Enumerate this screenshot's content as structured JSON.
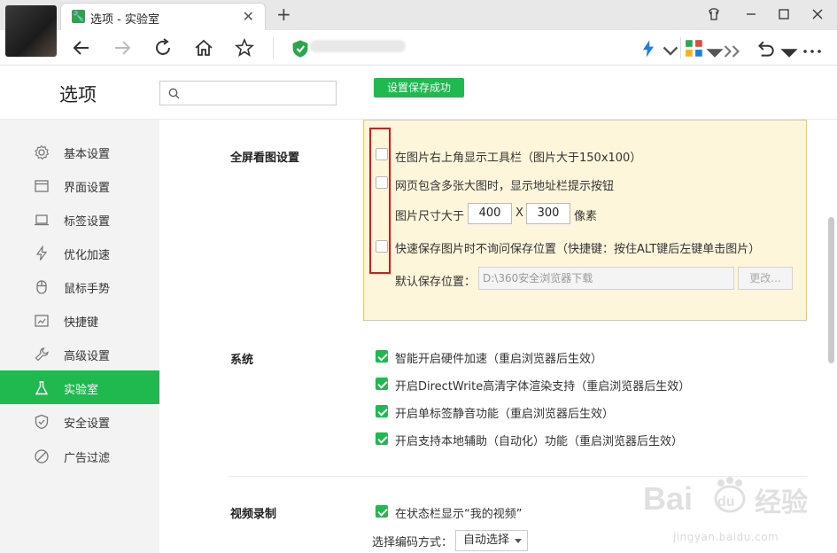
{
  "browser": {
    "tab_title": "选项 - 实验室",
    "tab_favicon": "wrench-icon",
    "new_tab_glyph": "+",
    "close_glyph": "✕"
  },
  "page": {
    "title": "选项",
    "search_placeholder": "",
    "save_notice": "设置保存成功"
  },
  "sidebar": {
    "items": [
      {
        "label": "基本设置",
        "icon": "gear-icon"
      },
      {
        "label": "界面设置",
        "icon": "window-icon"
      },
      {
        "label": "标签设置",
        "icon": "tab-icon"
      },
      {
        "label": "优化加速",
        "icon": "lightning-icon"
      },
      {
        "label": "鼠标手势",
        "icon": "mouse-icon"
      },
      {
        "label": "快捷键",
        "icon": "keyboard-icon"
      },
      {
        "label": "高级设置",
        "icon": "wrench-icon"
      },
      {
        "label": "实验室",
        "icon": "flask-icon",
        "active": true
      },
      {
        "label": "安全设置",
        "icon": "shield-icon"
      },
      {
        "label": "广告过滤",
        "icon": "block-icon"
      }
    ]
  },
  "fullscreen": {
    "title": "全屏看图设置",
    "opt1": "在图片右上角显示工具栏（图片大于150x100）",
    "opt2": "网页包含多张大图时，显示地址栏提示按钮",
    "size_label": "图片尺寸大于",
    "width": "400",
    "x": "X",
    "height": "300",
    "unit": "像素",
    "opt3": "快速保存图片时不询问保存位置（快捷键：按住ALT键后左键单击图片）",
    "path_label": "默认保存位置：",
    "path_value": "D:\\360安全浏览器下载",
    "change_label": "更改..."
  },
  "system": {
    "title": "系统",
    "options": [
      "智能开启硬件加速（重启浏览器后生效）",
      "开启DirectWrite高清字体渲染支持（重启浏览器后生效）",
      "开启单标签静音功能（重启浏览器后生效）",
      "开启支持本地辅助（自动化）功能（重启浏览器后生效）"
    ]
  },
  "video": {
    "title": "视频录制",
    "opt1": "在状态栏显示“我的视频”",
    "encode_label": "选择编码方式：",
    "encode_value": "自动选择"
  },
  "watermark": {
    "text": "jingyan.baidu.com"
  },
  "colors": {
    "accent": "#1fb94f",
    "highlight_border": "#e01515",
    "yellow_bg": "#fdf6db"
  }
}
